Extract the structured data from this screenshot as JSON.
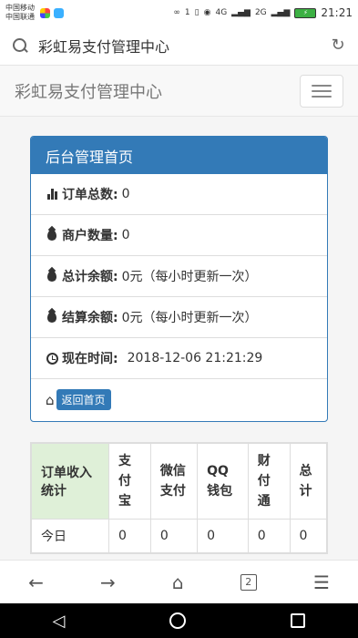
{
  "status_bar": {
    "carrier1": "中国移动",
    "carrier2": "中国联通",
    "network1": "4G",
    "network2": "2G",
    "battery": "",
    "time": "21:21",
    "notif_count": "1"
  },
  "address_bar": {
    "title": "彩虹易支付管理中心"
  },
  "navbar": {
    "brand": "彩虹易支付管理中心"
  },
  "panel": {
    "heading": "后台管理首页",
    "rows": [
      {
        "label": "订单总数:",
        "value": "0"
      },
      {
        "label": "商户数量:",
        "value": "0"
      },
      {
        "label": "总计余额:",
        "value": "0元（每小时更新一次）"
      },
      {
        "label": "结算余额:",
        "value": "0元（每小时更新一次）"
      },
      {
        "label": "现在时间:",
        "value": "2018-12-06 21:21:29"
      }
    ],
    "home_button": "返回首页"
  },
  "table": {
    "headers": [
      "订单收入统计",
      "支付宝",
      "微信支付",
      "QQ钱包",
      "财付通",
      "总计"
    ],
    "rows": [
      [
        "今日",
        "0",
        "0",
        "0",
        "0",
        "0"
      ]
    ]
  },
  "bottom_bar": {
    "tab_count": "2"
  }
}
